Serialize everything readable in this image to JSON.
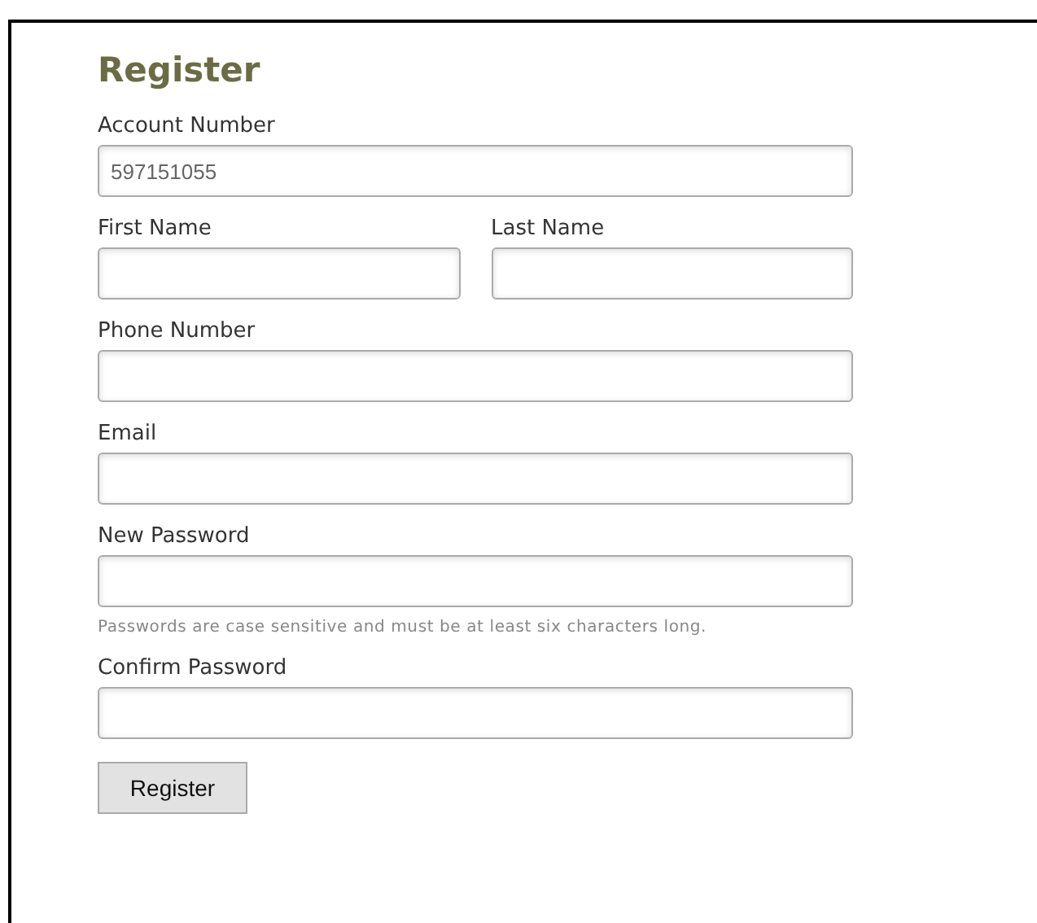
{
  "title": "Register",
  "rows": [
    {
      "fields": [
        {
          "label": "Account Number",
          "value": "597151055"
        }
      ]
    },
    {
      "fields": [
        {
          "label": "First Name"
        },
        {
          "label": "Last Name"
        }
      ]
    },
    {
      "fields": [
        {
          "label": "Phone Number"
        }
      ]
    },
    {
      "fields": [
        {
          "label": "Email"
        }
      ]
    },
    {
      "fields": [
        {
          "label": "New Password",
          "hint": "Passwords are case sensitive and must be at least six characters long."
        }
      ]
    },
    {
      "fields": [
        {
          "label": "Confirm Password"
        }
      ]
    }
  ],
  "submit": "Register"
}
